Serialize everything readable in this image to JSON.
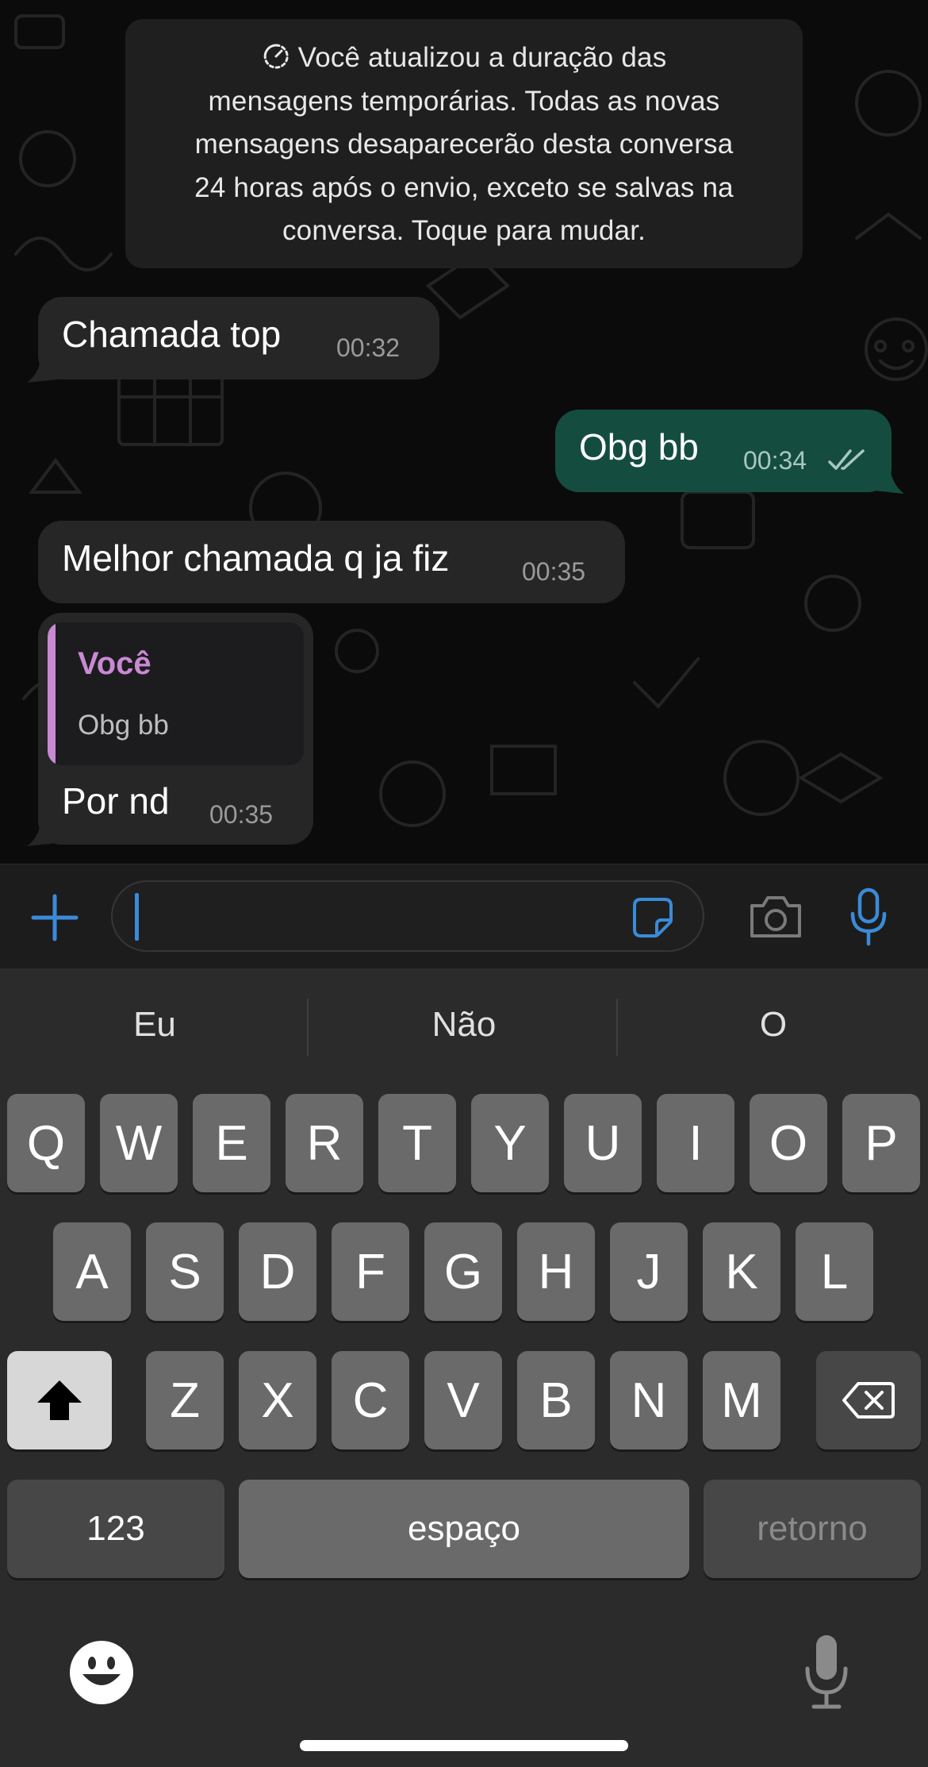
{
  "system_notice": {
    "lines": [
      "Você atualizou a duração das",
      "mensagens temporárias. Todas as novas",
      "mensagens desaparecerão desta conversa",
      "24 horas após o envio, exceto se salvas na",
      "conversa. Toque para mudar."
    ],
    "icon": "disappearing-timer-icon"
  },
  "messages": [
    {
      "direction": "incoming",
      "text": "Chamada top",
      "time": "00:32"
    },
    {
      "direction": "outgoing",
      "text": "Obg bb",
      "time": "00:34",
      "status_icon": "double-check-icon"
    },
    {
      "direction": "incoming",
      "text": "Melhor chamada q ja fiz",
      "time": "00:35"
    },
    {
      "direction": "incoming",
      "text": "Por nd",
      "time": "00:35",
      "reply_to": {
        "author": "Você",
        "text": "Obg bb"
      }
    }
  ],
  "composer": {
    "value": "",
    "icons": [
      "plus-icon",
      "sticker-icon",
      "camera-icon",
      "microphone-icon"
    ]
  },
  "keyboard": {
    "suggestions": [
      "Eu",
      "Não",
      "O"
    ],
    "row1": [
      "Q",
      "W",
      "E",
      "R",
      "T",
      "Y",
      "U",
      "I",
      "O",
      "P"
    ],
    "row2": [
      "A",
      "S",
      "D",
      "F",
      "G",
      "H",
      "J",
      "K",
      "L"
    ],
    "row3": [
      "Z",
      "X",
      "C",
      "V",
      "B",
      "N",
      "M"
    ],
    "numbers_label": "123",
    "space_label": "espaço",
    "return_label": "retorno",
    "icons": [
      "shift-icon",
      "backspace-icon",
      "emoji-icon",
      "dictation-icon"
    ]
  },
  "colors": {
    "outgoing_bubble": "#144d40",
    "incoming_bubble": "#262626",
    "accent_blue": "#3a8bd8",
    "quote_author": "#c989d3"
  }
}
